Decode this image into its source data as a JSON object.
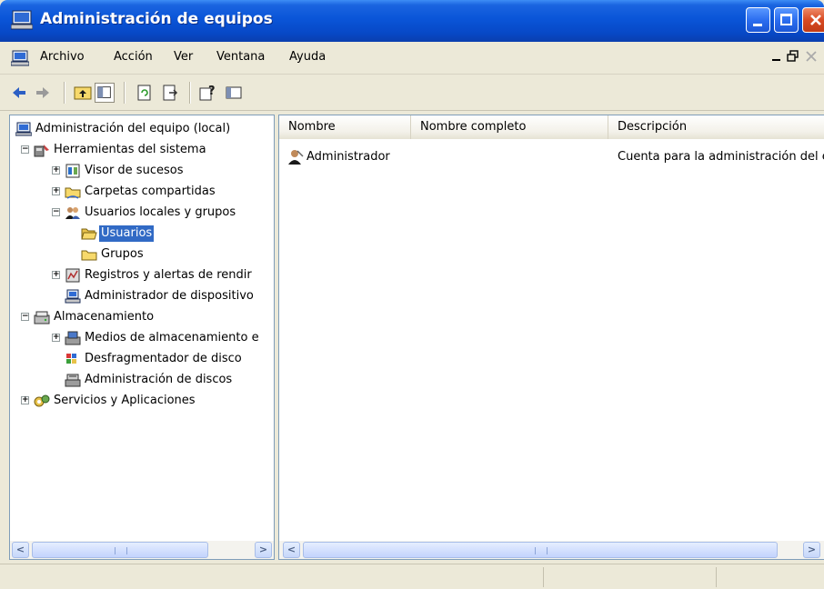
{
  "window": {
    "title": "Administración de equipos"
  },
  "menu": {
    "items": [
      "Archivo",
      "Acción",
      "Ver",
      "Ventana",
      "Ayuda"
    ]
  },
  "tree": {
    "items": [
      {
        "label": "Administración del equipo (local)"
      },
      {
        "label": "Herramientas del sistema"
      },
      {
        "label": "Visor de sucesos"
      },
      {
        "label": "Carpetas compartidas"
      },
      {
        "label": "Usuarios locales y grupos"
      },
      {
        "label": "Usuarios",
        "selected": true
      },
      {
        "label": "Grupos"
      },
      {
        "label": "Registros y alertas de rendir"
      },
      {
        "label": "Administrador de dispositivo"
      },
      {
        "label": "Almacenamiento"
      },
      {
        "label": "Medios de almacenamiento e"
      },
      {
        "label": "Desfragmentador de disco"
      },
      {
        "label": "Administración de discos"
      },
      {
        "label": "Servicios y Aplicaciones"
      }
    ]
  },
  "list": {
    "columns": [
      "Nombre",
      "Nombre completo",
      "Descripción"
    ],
    "rows": [
      {
        "name": "Administrador",
        "full_name": "",
        "description": "Cuenta para la administración del e"
      }
    ]
  },
  "icons": {
    "back": "back-arrow-icon",
    "forward": "forward-arrow-icon",
    "up": "up-folder-icon",
    "tree_toggle": "show-hide-tree-icon",
    "refresh": "refresh-icon",
    "export": "export-list-icon",
    "help": "help-icon",
    "console": "console-icon"
  },
  "colors": {
    "title_bar": "#0a55d8",
    "selection": "#316ac5",
    "face": "#ece9d8"
  }
}
